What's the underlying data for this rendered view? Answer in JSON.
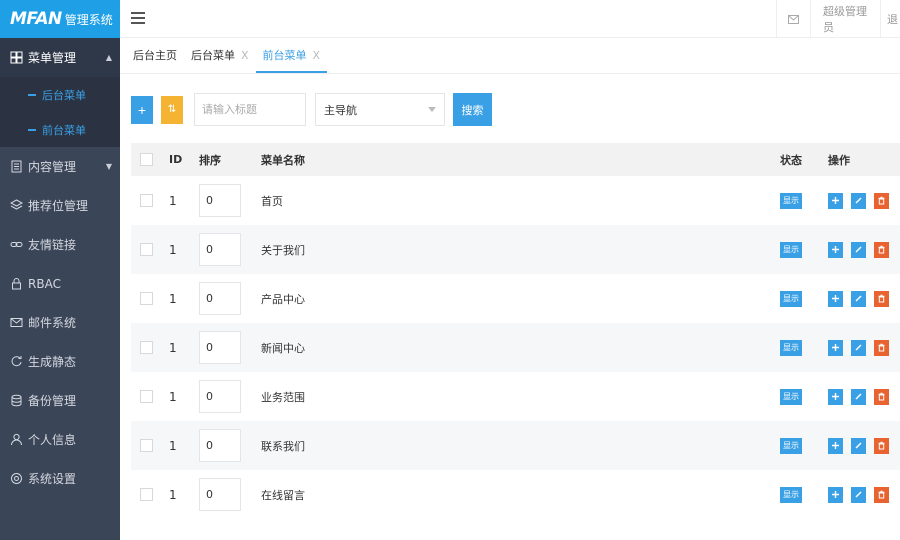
{
  "brand": {
    "mark": "MFAN",
    "text": "管理系统"
  },
  "header": {
    "user_label": "超级管理员",
    "cut_label": "退"
  },
  "sidebar": {
    "items": [
      {
        "label": "菜单管理",
        "icon": "grid-icon",
        "open": true,
        "children": [
          {
            "label": "后台菜单"
          },
          {
            "label": "前台菜单"
          }
        ]
      },
      {
        "label": "内容管理",
        "icon": "document-icon",
        "arrow": true
      },
      {
        "label": "推荐位管理",
        "icon": "layers-icon"
      },
      {
        "label": "友情链接",
        "icon": "link-icon"
      },
      {
        "label": "RBAC",
        "icon": "lock-icon"
      },
      {
        "label": "邮件系统",
        "icon": "mail-icon"
      },
      {
        "label": "生成静态",
        "icon": "refresh-icon"
      },
      {
        "label": "备份管理",
        "icon": "database-icon"
      },
      {
        "label": "个人信息",
        "icon": "user-icon"
      },
      {
        "label": "系统设置",
        "icon": "settings-icon"
      }
    ]
  },
  "tabs": [
    {
      "label": "后台主页",
      "closable": false,
      "active": false
    },
    {
      "label": "后台菜单",
      "closable": true,
      "active": false
    },
    {
      "label": "前台菜单",
      "closable": true,
      "active": true
    }
  ],
  "tab_close": "X",
  "toolbar": {
    "add_label": "+",
    "sort_label": "⇅",
    "search_placeholder": "请输入标题",
    "select_value": "主导航",
    "search_button": "搜索"
  },
  "table": {
    "headers": {
      "id": "ID",
      "sort": "排序",
      "name": "菜单名称",
      "status": "状态",
      "ops": "操作"
    },
    "rows": [
      {
        "id": "1",
        "sort": "0",
        "name": "首页",
        "status": "显示"
      },
      {
        "id": "1",
        "sort": "0",
        "name": "关于我们",
        "status": "显示"
      },
      {
        "id": "1",
        "sort": "0",
        "name": "产品中心",
        "status": "显示"
      },
      {
        "id": "1",
        "sort": "0",
        "name": "新闻中心",
        "status": "显示"
      },
      {
        "id": "1",
        "sort": "0",
        "name": "业务范围",
        "status": "显示"
      },
      {
        "id": "1",
        "sort": "0",
        "name": "联系我们",
        "status": "显示"
      },
      {
        "id": "1",
        "sort": "0",
        "name": "在线留言",
        "status": "显示"
      }
    ]
  },
  "colors": {
    "primary": "#3aa0e6",
    "warning": "#f5b333",
    "danger": "#e8632f",
    "sidebar": "#3b4558"
  }
}
